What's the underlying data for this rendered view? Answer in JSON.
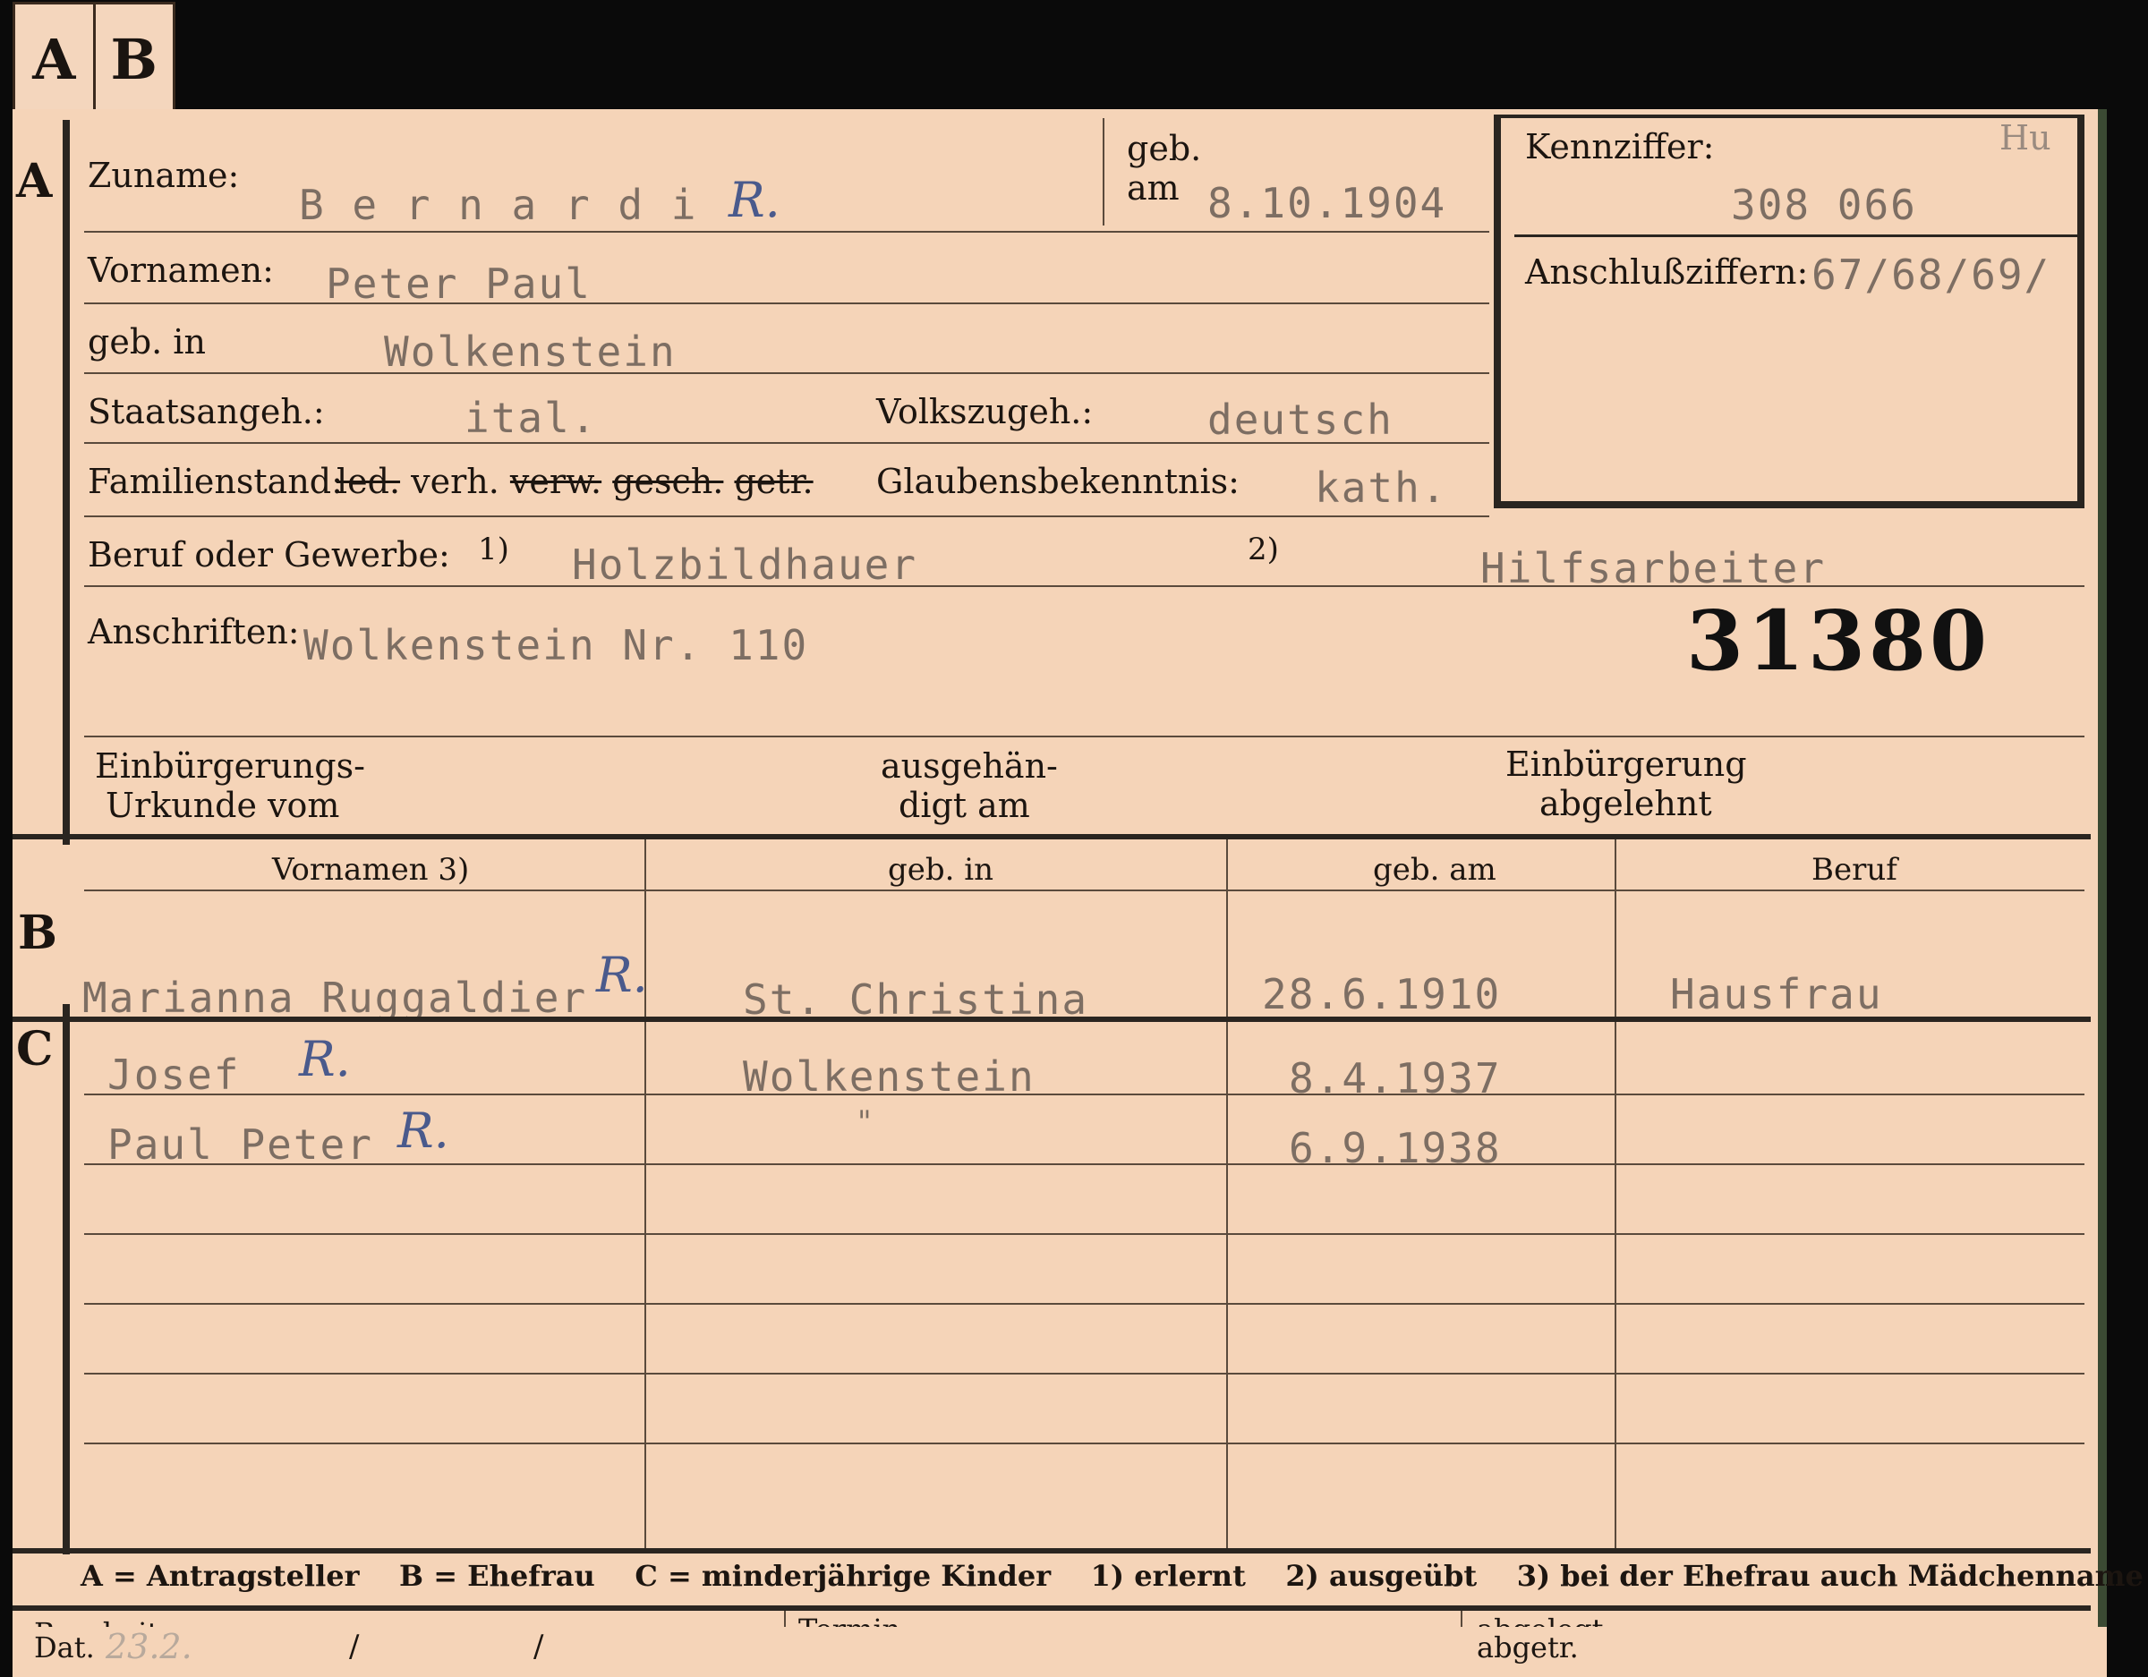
{
  "tabs": [
    "A",
    "B"
  ],
  "section_letters": {
    "a": "A",
    "b": "B",
    "c": "C"
  },
  "person": {
    "surname_label": "Zuname:",
    "surname": "B e r n a r d i",
    "surname_mark": "R.",
    "born_on_label_1": "geb.",
    "born_on_label_2": "am",
    "born_on": "8.10.1904",
    "given_names_label": "Vornamen:",
    "given_names": "Peter Paul",
    "birthplace_label": "geb. in",
    "birthplace": "Wolkenstein",
    "citizenship_label": "Staatsangeh.:",
    "citizenship": "ital.",
    "ethnicity_label": "Volkszugeh.:",
    "ethnicity": "deutsch",
    "marital_label": "Familienstand:",
    "marital_options": [
      "led.",
      "verh.",
      "verw.",
      "gesch.",
      "getr."
    ],
    "religion_label": "Glaubensbekenntnis:",
    "religion": "kath.",
    "occupation_label": "Beruf oder Gewerbe:",
    "occ1_marker": "1)",
    "occupation_learned": "Holzbildhauer",
    "occ2_marker": "2)",
    "occupation_practiced": "Hilfsarbeiter",
    "address_label": "Anschriften:",
    "address": "Wolkenstein Nr. 110",
    "stamp_number": "31380",
    "naturalization_doc_label_1": "Einbürgerungs-",
    "naturalization_doc_label_2": "Urkunde vom",
    "handed_over_label_1": "ausgehän-",
    "handed_over_label_2": "digt am",
    "naturalization_refused_label_1": "Einbürgerung",
    "naturalization_refused_label_2": "abgelehnt"
  },
  "reference": {
    "code_label": "Kennziffer:",
    "code_note": "Hu",
    "code": "308 066",
    "linked_label": "Anschlußziffern:",
    "linked": "67/68/69/"
  },
  "family_table": {
    "headers": [
      "Vornamen 3)",
      "geb. in",
      "geb. am",
      "Beruf"
    ],
    "wife": {
      "name": "Marianna Ruggaldier",
      "mark": "R.",
      "birthplace": "St. Christina",
      "born_on": "28.6.1910",
      "occupation": "Hausfrau"
    },
    "children": [
      {
        "name": "Josef",
        "mark": "R.",
        "birthplace": "Wolkenstein",
        "born_on": "8.4.1937",
        "occupation": ""
      },
      {
        "name": "Paul Peter",
        "mark": "R.",
        "birthplace": "\"",
        "born_on": "6.9.1938",
        "occupation": ""
      }
    ]
  },
  "legend": {
    "a": "A = Antragsteller",
    "b": "B = Ehefrau",
    "c": "C = minderjährige Kinder",
    "n1": "1) erlernt",
    "n2": "2) ausgeübt",
    "n3": "3) bei der Ehefrau auch Mädchenname"
  },
  "footer": {
    "processor_label": "Bearbeiter:",
    "date_label": "Dat.",
    "date_handwritten": "23.2.",
    "date_sep1": "/",
    "date_sep2": "/",
    "deadline_label": "Termin",
    "filed_label": "abgelegt",
    "processed_label": "abgetr."
  }
}
